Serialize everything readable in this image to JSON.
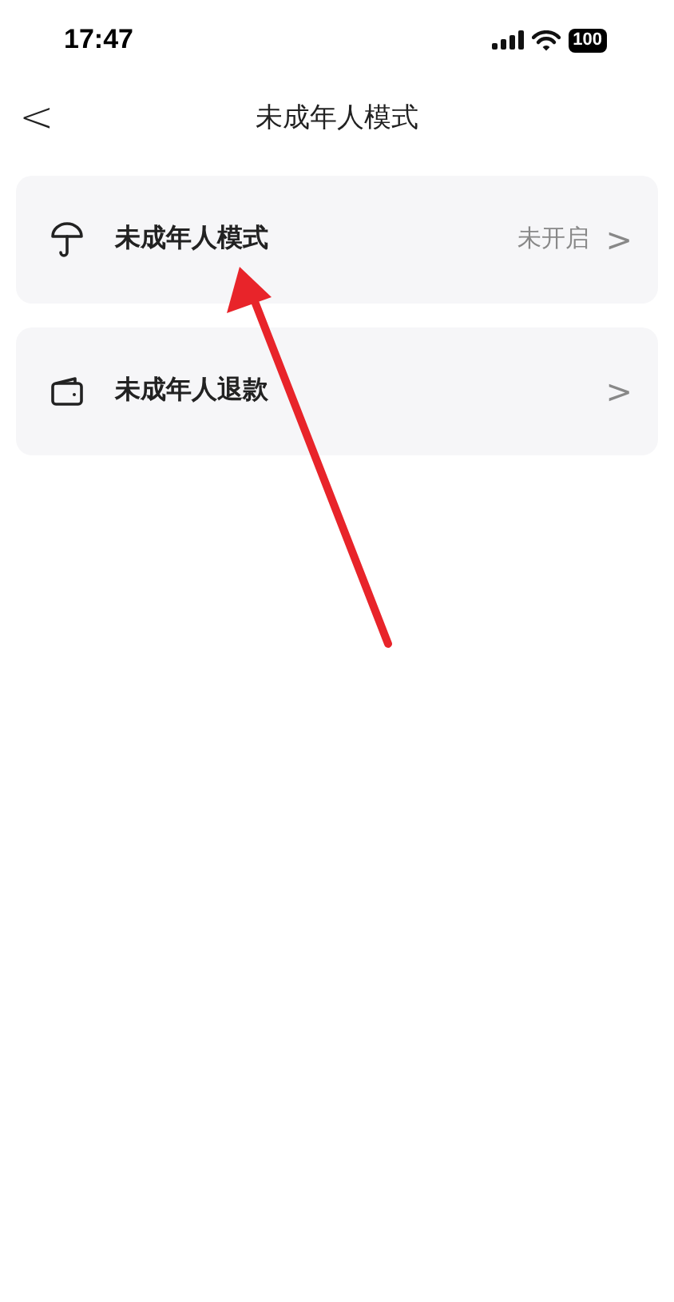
{
  "status_bar": {
    "time": "17:47",
    "battery": "100"
  },
  "nav": {
    "back": "<",
    "title": "未成年人模式"
  },
  "items": [
    {
      "kind": "umbrella",
      "label": "未成年人模式",
      "value": "未开启",
      "chevron": ">"
    },
    {
      "kind": "wallet",
      "label": "未成年人退款",
      "chevron": ">"
    }
  ]
}
